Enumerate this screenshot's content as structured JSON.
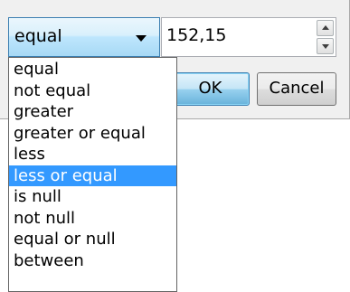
{
  "filter": {
    "operator": {
      "selected": "equal",
      "options": [
        "equal",
        "not equal",
        "greater",
        "greater or equal",
        "less",
        "less or equal",
        "is null",
        "not null",
        "equal or null",
        "between"
      ],
      "highlighted": "less or equal"
    },
    "value": "152,15"
  },
  "buttons": {
    "ok_label": "OK",
    "cancel_label": "Cancel"
  },
  "colors": {
    "highlight": "#3399ff",
    "focus_border": "#3c7fb1"
  },
  "icons": {
    "dropdown": "chevron-down-icon",
    "spin_up": "spin-up-icon",
    "spin_down": "spin-down-icon"
  }
}
